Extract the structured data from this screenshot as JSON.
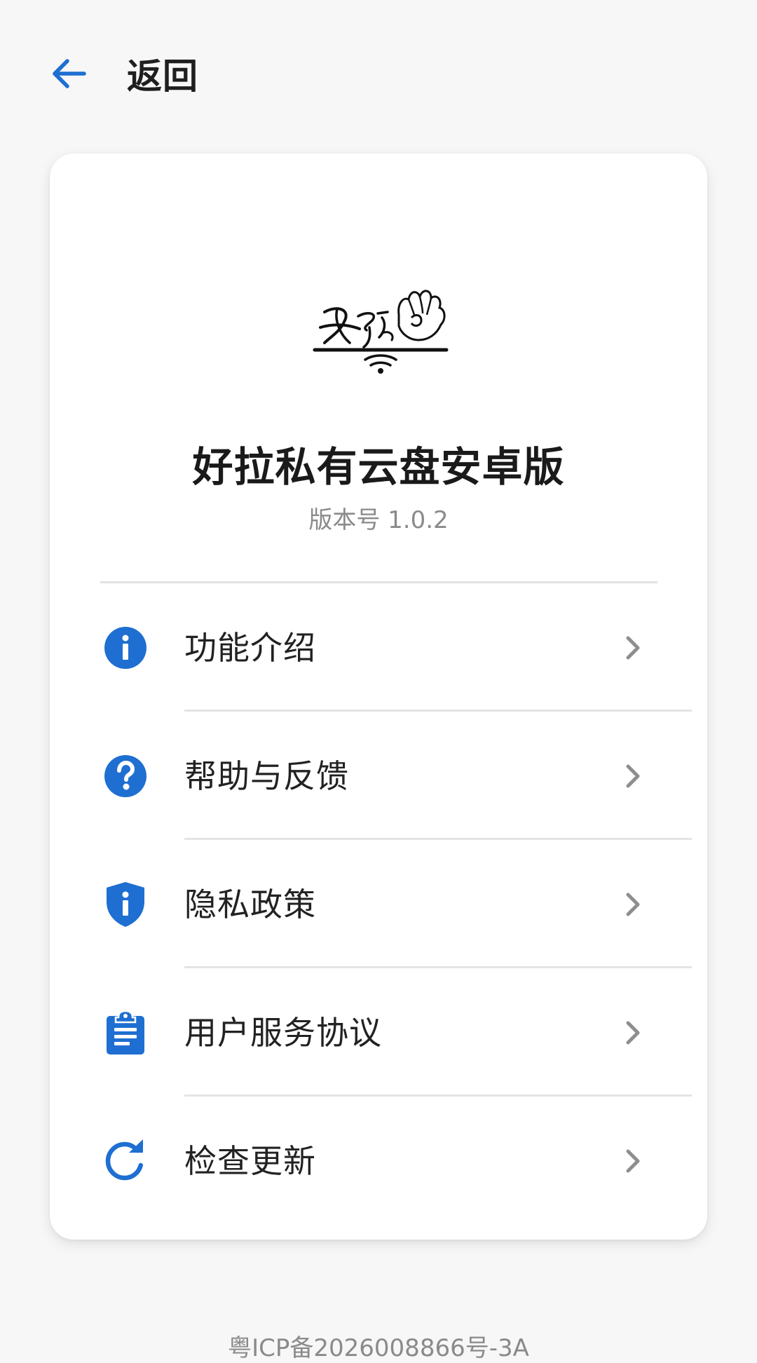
{
  "header": {
    "back_label": "返回"
  },
  "app": {
    "name": "好拉私有云盘安卓版",
    "version": "版本号 1.0.2"
  },
  "menu": {
    "items": [
      {
        "label": "功能介绍",
        "icon": "info-circle-icon"
      },
      {
        "label": "帮助与反馈",
        "icon": "help-circle-icon"
      },
      {
        "label": "隐私政策",
        "icon": "shield-info-icon"
      },
      {
        "label": "用户服务协议",
        "icon": "clipboard-icon"
      },
      {
        "label": "检查更新",
        "icon": "refresh-icon"
      }
    ]
  },
  "footer": {
    "icp": "粤ICP备2026008866号-3A"
  },
  "colors": {
    "accent": "#1e6fd1",
    "chevron": "#8e8e8e"
  }
}
